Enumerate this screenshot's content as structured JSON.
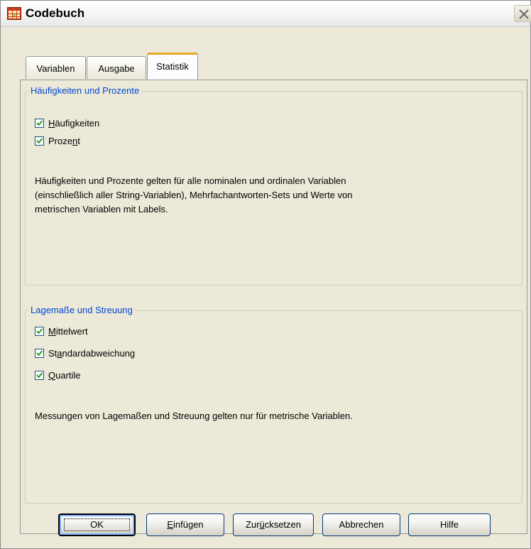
{
  "window": {
    "title": "Codebuch"
  },
  "tabs": [
    {
      "label": "Variablen",
      "active": false
    },
    {
      "label": "Ausgabe",
      "active": false
    },
    {
      "label": "Statistik",
      "active": true
    }
  ],
  "group_frequencies": {
    "legend": "Häufigkeiten und Prozente",
    "checkboxes": [
      {
        "mnemonic": "H",
        "rest": "äufigkeiten",
        "checked": true
      },
      {
        "pre": "Proze",
        "mnemonic": "n",
        "rest": "t",
        "checked": true
      }
    ],
    "description_lines": [
      "Häufigkeiten und Prozente gelten für alle nominalen und ordinalen Variablen",
      "(einschließlich aller String-Variablen), Mehrfachantworten-Sets und Werte von",
      "metrischen Variablen mit Labels."
    ]
  },
  "group_location": {
    "legend": "Lagemaße und Streuung",
    "checkboxes": [
      {
        "mnemonic": "M",
        "rest": "ittelwert",
        "checked": true
      },
      {
        "pre": "St",
        "mnemonic": "a",
        "rest": "ndardabweichung",
        "checked": true
      },
      {
        "mnemonic": "Q",
        "rest": "uartile",
        "checked": true
      }
    ],
    "description": "Messungen von Lagemaßen und Streuung gelten nur für metrische Variablen."
  },
  "buttons": {
    "ok": "OK",
    "paste_mnemonic": "E",
    "paste_rest": "infügen",
    "reset_pre": "Zur",
    "reset_mnemonic": "ü",
    "reset_rest": "cksetzen",
    "cancel": "Abbrechen",
    "help": "Hilfe"
  },
  "colors": {
    "dialog_bg": "#ece9d8",
    "legend_text": "#0046d5",
    "active_tab_accent": "#e6a52b",
    "check_mark": "#21a121"
  }
}
